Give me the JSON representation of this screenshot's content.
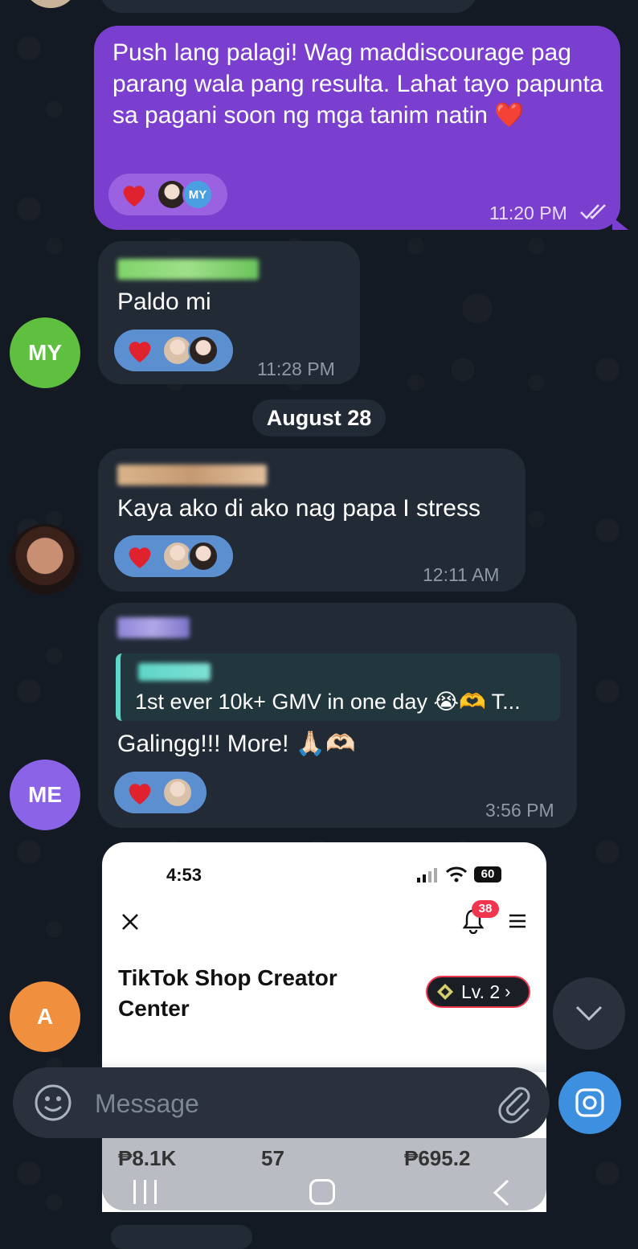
{
  "messages": {
    "outgoing": {
      "text": "Push lang palagi! Wag maddiscourage pag parang wala pang resulta. Lahat tayo papunta sa pagani soon ng mga tanim natin ❤️",
      "time": "11:20 PM",
      "reactor_initials": "MY"
    },
    "msg1": {
      "avatar_initials": "MY",
      "avatar_color": "#5fbf3f",
      "text": "Paldo mi",
      "time": "11:28 PM"
    },
    "date_separator": "August 28",
    "msg2": {
      "text": "Kaya ako di ako nag papa I stress",
      "time": "12:11 AM"
    },
    "msg3": {
      "avatar_initials": "ME",
      "avatar_color": "#8a63e6",
      "reply_text": "1st ever 10k+ GMV in one day 😭🫶  T...",
      "text": "Galingg!!! More! 🙏🏻🫶🏻",
      "time": "3:56 PM"
    },
    "msg4": {
      "avatar_initials": "A",
      "avatar_color": "#f0903e"
    }
  },
  "screenshot": {
    "status_time": "4:53",
    "battery": "60",
    "notif_count": "38",
    "title": "TikTok Shop Creator Center",
    "level": "Lv. 2",
    "stats": [
      "₱8.1K",
      "57",
      "₱695.2"
    ]
  },
  "composer": {
    "placeholder": "Message"
  },
  "colors": {
    "background": "#141a23",
    "incoming_bubble": "#222a36",
    "outgoing_bubble": "#7b3fd0",
    "accent": "#3d8fe0"
  }
}
